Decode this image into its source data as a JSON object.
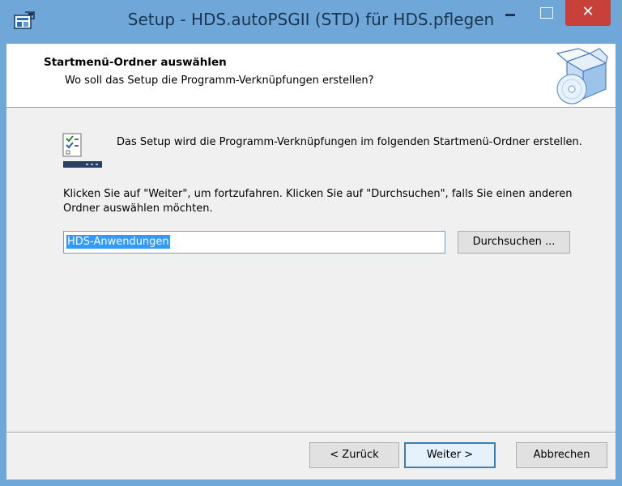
{
  "window": {
    "title": "Setup - HDS.autoPSGII (STD) für HDS.pflegen",
    "controls": {
      "minimize_icon": "minimize-icon",
      "maximize_icon": "maximize-icon",
      "close_label": "✕"
    }
  },
  "header": {
    "title": "Startmenü-Ordner auswählen",
    "subtitle": "Wo soll das Setup die Programm-Verknüpfungen erstellen?",
    "image_icon": "setup-box-cd-icon"
  },
  "content": {
    "info_text": "Das Setup wird die Programm-Verknüpfungen im folgenden Startmenü-Ordner erstellen.",
    "hint_text": "Klicken Sie auf \"Weiter\", um fortzufahren. Klicken Sie auf \"Durchsuchen\", falls Sie einen anderen Ordner auswählen möchten.",
    "folder_input_value": "HDS-Anwendungen",
    "browse_label": "Durchsuchen ..."
  },
  "footer": {
    "back_label": "< Zurück",
    "next_label": "Weiter >",
    "cancel_label": "Abbrechen"
  },
  "colors": {
    "titlebar": "#6fa8d8",
    "close_button": "#c7403a",
    "selection": "#3399ff"
  }
}
